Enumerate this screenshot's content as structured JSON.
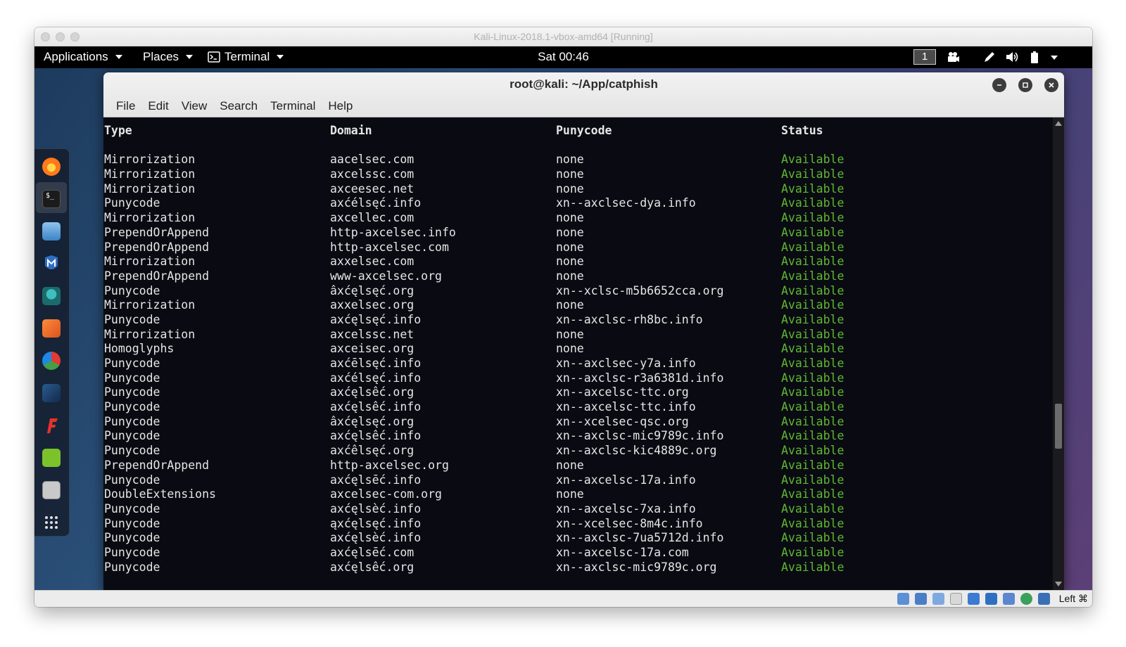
{
  "host": {
    "title": "Kali-Linux-2018.1-vbox-amd64 [Running]",
    "host_key": "Left ⌘"
  },
  "topbar": {
    "applications": "Applications",
    "places": "Places",
    "terminal": "Terminal",
    "clock": "Sat 00:46",
    "workspace": "1"
  },
  "dock": {
    "items": [
      "firefox-icon",
      "terminal-icon",
      "files-icon",
      "maltego-icon",
      "user-icon",
      "burpsuite-icon",
      "armitage-icon",
      "metasploit-icon",
      "faraday-icon",
      "leafpad-icon",
      "screenshot-icon",
      "show-apps-icon"
    ]
  },
  "terminal": {
    "title": "root@kali: ~/App/catphish",
    "menu": [
      "File",
      "Edit",
      "View",
      "Search",
      "Terminal",
      "Help"
    ],
    "headers": [
      "Type",
      "Domain",
      "Punycode",
      "Status"
    ],
    "rows": [
      [
        "Mirrorization",
        "aacelsec.com",
        "none",
        "Available"
      ],
      [
        "Mirrorization",
        "axcelssc.com",
        "none",
        "Available"
      ],
      [
        "Mirrorization",
        "axceesec.net",
        "none",
        "Available"
      ],
      [
        "Punycode",
        "axćélsęć.info",
        "xn--axclsec-dya.info",
        "Available"
      ],
      [
        "Mirrorization",
        "axcellec.com",
        "none",
        "Available"
      ],
      [
        "PrependOrAppend",
        "http-axcelsec.info",
        "none",
        "Available"
      ],
      [
        "PrependOrAppend",
        "http-axcelsec.com",
        "none",
        "Available"
      ],
      [
        "Mirrorization",
        "axxelsec.com",
        "none",
        "Available"
      ],
      [
        "PrependOrAppend",
        "www-axcelsec.org",
        "none",
        "Available"
      ],
      [
        "Punycode",
        "âxćęlsęć.org",
        "xn--xclsc-m5b6652cca.org",
        "Available"
      ],
      [
        "Mirrorization",
        "axxelsec.org",
        "none",
        "Available"
      ],
      [
        "Punycode",
        "axćęlsęć.info",
        "xn--axclsc-rh8bc.info",
        "Available"
      ],
      [
        "Mirrorization",
        "axcelssc.net",
        "none",
        "Available"
      ],
      [
        "Homoglyphs",
        "axceisec.org",
        "none",
        "Available"
      ],
      [
        "Punycode",
        "axćēlsęć.info",
        "xn--axclsec-y7a.info",
        "Available"
      ],
      [
        "Punycode",
        "axćélsęć.info",
        "xn--axclsc-r3a6381d.info",
        "Available"
      ],
      [
        "Punycode",
        "axćęlsêć.org",
        "xn--axcelsc-ttc.org",
        "Available"
      ],
      [
        "Punycode",
        "axćęlsêć.info",
        "xn--axcelsc-ttc.info",
        "Available"
      ],
      [
        "Punycode",
        "âxćęlsęć.org",
        "xn--xcelsec-qsc.org",
        "Available"
      ],
      [
        "Punycode",
        "axćęlsêć.info",
        "xn--axclsc-mic9789c.info",
        "Available"
      ],
      [
        "Punycode",
        "axćêlsęć.org",
        "xn--axclsc-kic4889c.org",
        "Available"
      ],
      [
        "PrependOrAppend",
        "http-axcelsec.org",
        "none",
        "Available"
      ],
      [
        "Punycode",
        "axćęlsēć.info",
        "xn--axcelsc-17a.info",
        "Available"
      ],
      [
        "DoubleExtensions",
        "axcelsec-com.org",
        "none",
        "Available"
      ],
      [
        "Punycode",
        "axćęlsèć.info",
        "xn--axcelsc-7xa.info",
        "Available"
      ],
      [
        "Punycode",
        "ąxćęlsęć.info",
        "xn--xcelsec-8m4c.info",
        "Available"
      ],
      [
        "Punycode",
        "axćęlsèć.info",
        "xn--axclsc-7ua5712d.info",
        "Available"
      ],
      [
        "Punycode",
        "axćęlsēć.com",
        "xn--axcelsc-17a.com",
        "Available"
      ],
      [
        "Punycode",
        "axćęlsêć.org",
        "xn--axclsc-mic9789c.org",
        "Available"
      ]
    ]
  },
  "colors": {
    "status_available": "#5fb832",
    "terminal_bg": "#0a0b12",
    "topbar_bg": "#000000"
  }
}
